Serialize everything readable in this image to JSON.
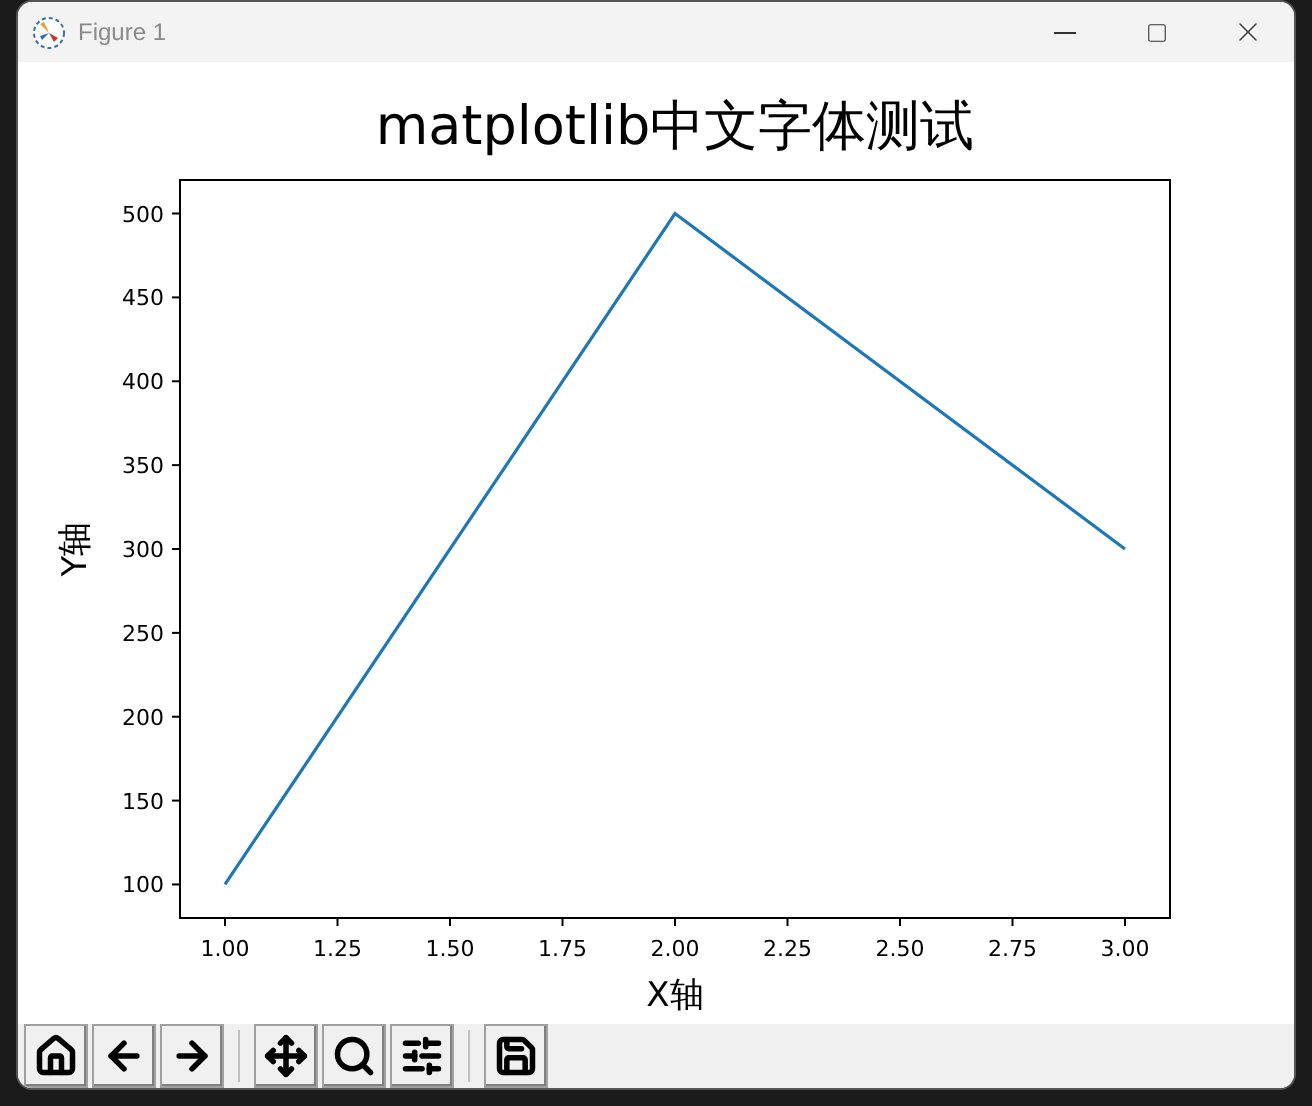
{
  "window": {
    "title": "Figure 1"
  },
  "figure": {
    "chart_data": {
      "type": "line",
      "title": "matplotlib中文字体测试",
      "xlabel": "X轴",
      "ylabel": "Y轴",
      "x": [
        1,
        2,
        3
      ],
      "series": [
        {
          "color": "#1f77b4",
          "values": [
            100,
            500,
            300
          ]
        }
      ],
      "xlim": [
        0.9,
        3.1
      ],
      "ylim": [
        80,
        520
      ],
      "xticks": [
        {
          "value": 1,
          "label": "1.00"
        },
        {
          "value": 1.25,
          "label": "1.25"
        },
        {
          "value": 1.5,
          "label": "1.50"
        },
        {
          "value": 1.75,
          "label": "1.75"
        },
        {
          "value": 2,
          "label": "2.00"
        },
        {
          "value": 2.25,
          "label": "2.25"
        },
        {
          "value": 2.5,
          "label": "2.50"
        },
        {
          "value": 2.75,
          "label": "2.75"
        },
        {
          "value": 3,
          "label": "3.00"
        }
      ],
      "yticks": [
        100,
        150,
        200,
        250,
        300,
        350,
        400,
        450,
        500
      ]
    }
  }
}
